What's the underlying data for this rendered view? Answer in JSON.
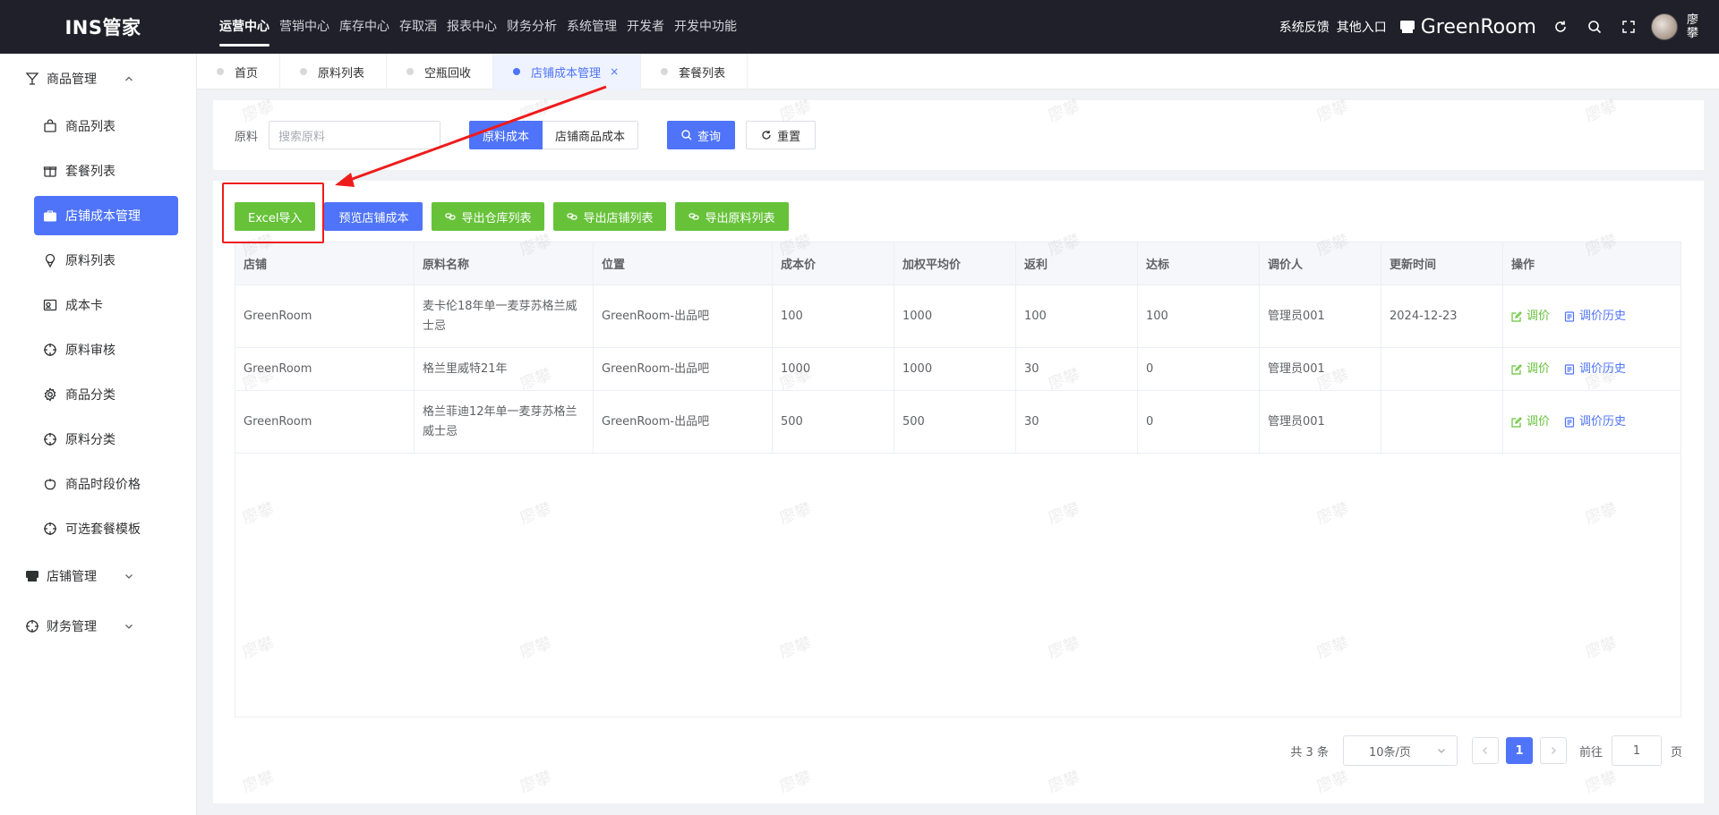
{
  "app": {
    "logo": "INS管家",
    "top_nav": [
      "运营中心",
      "营销中心",
      "库存中心",
      "存取酒",
      "报表中心",
      "财务分析",
      "系统管理",
      "开发者",
      "开发中功能"
    ],
    "active_top_nav": "运营中心",
    "feedback": "系统反馈",
    "other_entry": "其他入口",
    "store_name": "GreenRoom",
    "user_name": "廖攀"
  },
  "sidebar": {
    "group1": "商品管理",
    "items": [
      "商品列表",
      "套餐列表",
      "店铺成本管理",
      "原料列表",
      "成本卡",
      "原料审核",
      "商品分类",
      "原料分类",
      "商品时段价格",
      "可选套餐模板"
    ],
    "active_item": "店铺成本管理",
    "group2": "店铺管理",
    "group3": "财务管理"
  },
  "tabs": [
    {
      "label": "首页"
    },
    {
      "label": "原料列表"
    },
    {
      "label": "空瓶回收"
    },
    {
      "label": "店铺成本管理",
      "close": "×"
    },
    {
      "label": "套餐列表"
    }
  ],
  "search": {
    "label": "原料",
    "placeholder": "搜索原料",
    "seg_cost": "原料成本",
    "seg_store_cost": "店铺商品成本",
    "query": "查询",
    "reset": "重置"
  },
  "toolbar": {
    "excel_import": "Excel导入",
    "preview_cost": "预览店铺成本",
    "export_warehouse": "导出仓库列表",
    "export_store": "导出店铺列表",
    "export_material": "导出原料列表"
  },
  "table": {
    "headers": [
      "店铺",
      "原料名称",
      "位置",
      "成本价",
      "加权平均价",
      "返利",
      "达标",
      "调价人",
      "更新时间",
      "操作"
    ],
    "rows": [
      {
        "store": "GreenRoom",
        "name": "麦卡伦18年单一麦芽苏格兰威士忌",
        "location": "GreenRoom-出品吧",
        "cost": "100",
        "avg": "1000",
        "rebate": "100",
        "target": "100",
        "operator": "管理员001",
        "updated": "2024-12-23"
      },
      {
        "store": "GreenRoom",
        "name": "格兰里威特21年",
        "location": "GreenRoom-出品吧",
        "cost": "1000",
        "avg": "1000",
        "rebate": "30",
        "target": "0",
        "operator": "管理员001",
        "updated": ""
      },
      {
        "store": "GreenRoom",
        "name": "格兰菲迪12年单一麦芽苏格兰威士忌",
        "location": "GreenRoom-出品吧",
        "cost": "500",
        "avg": "500",
        "rebate": "30",
        "target": "0",
        "operator": "管理员001",
        "updated": ""
      }
    ],
    "action_adjust": "调价",
    "action_history": "调价历史"
  },
  "pager": {
    "total": "共 3 条",
    "page_size": "10条/页",
    "current_page": "1",
    "goto_label": "前往",
    "goto_value": "1",
    "page_suffix": "页"
  },
  "watermark": "廖攀",
  "colors": {
    "primary": "#4f74f9",
    "success": "#67c23a",
    "topbar": "#1f2029",
    "annotation": "#ee1c1c"
  }
}
